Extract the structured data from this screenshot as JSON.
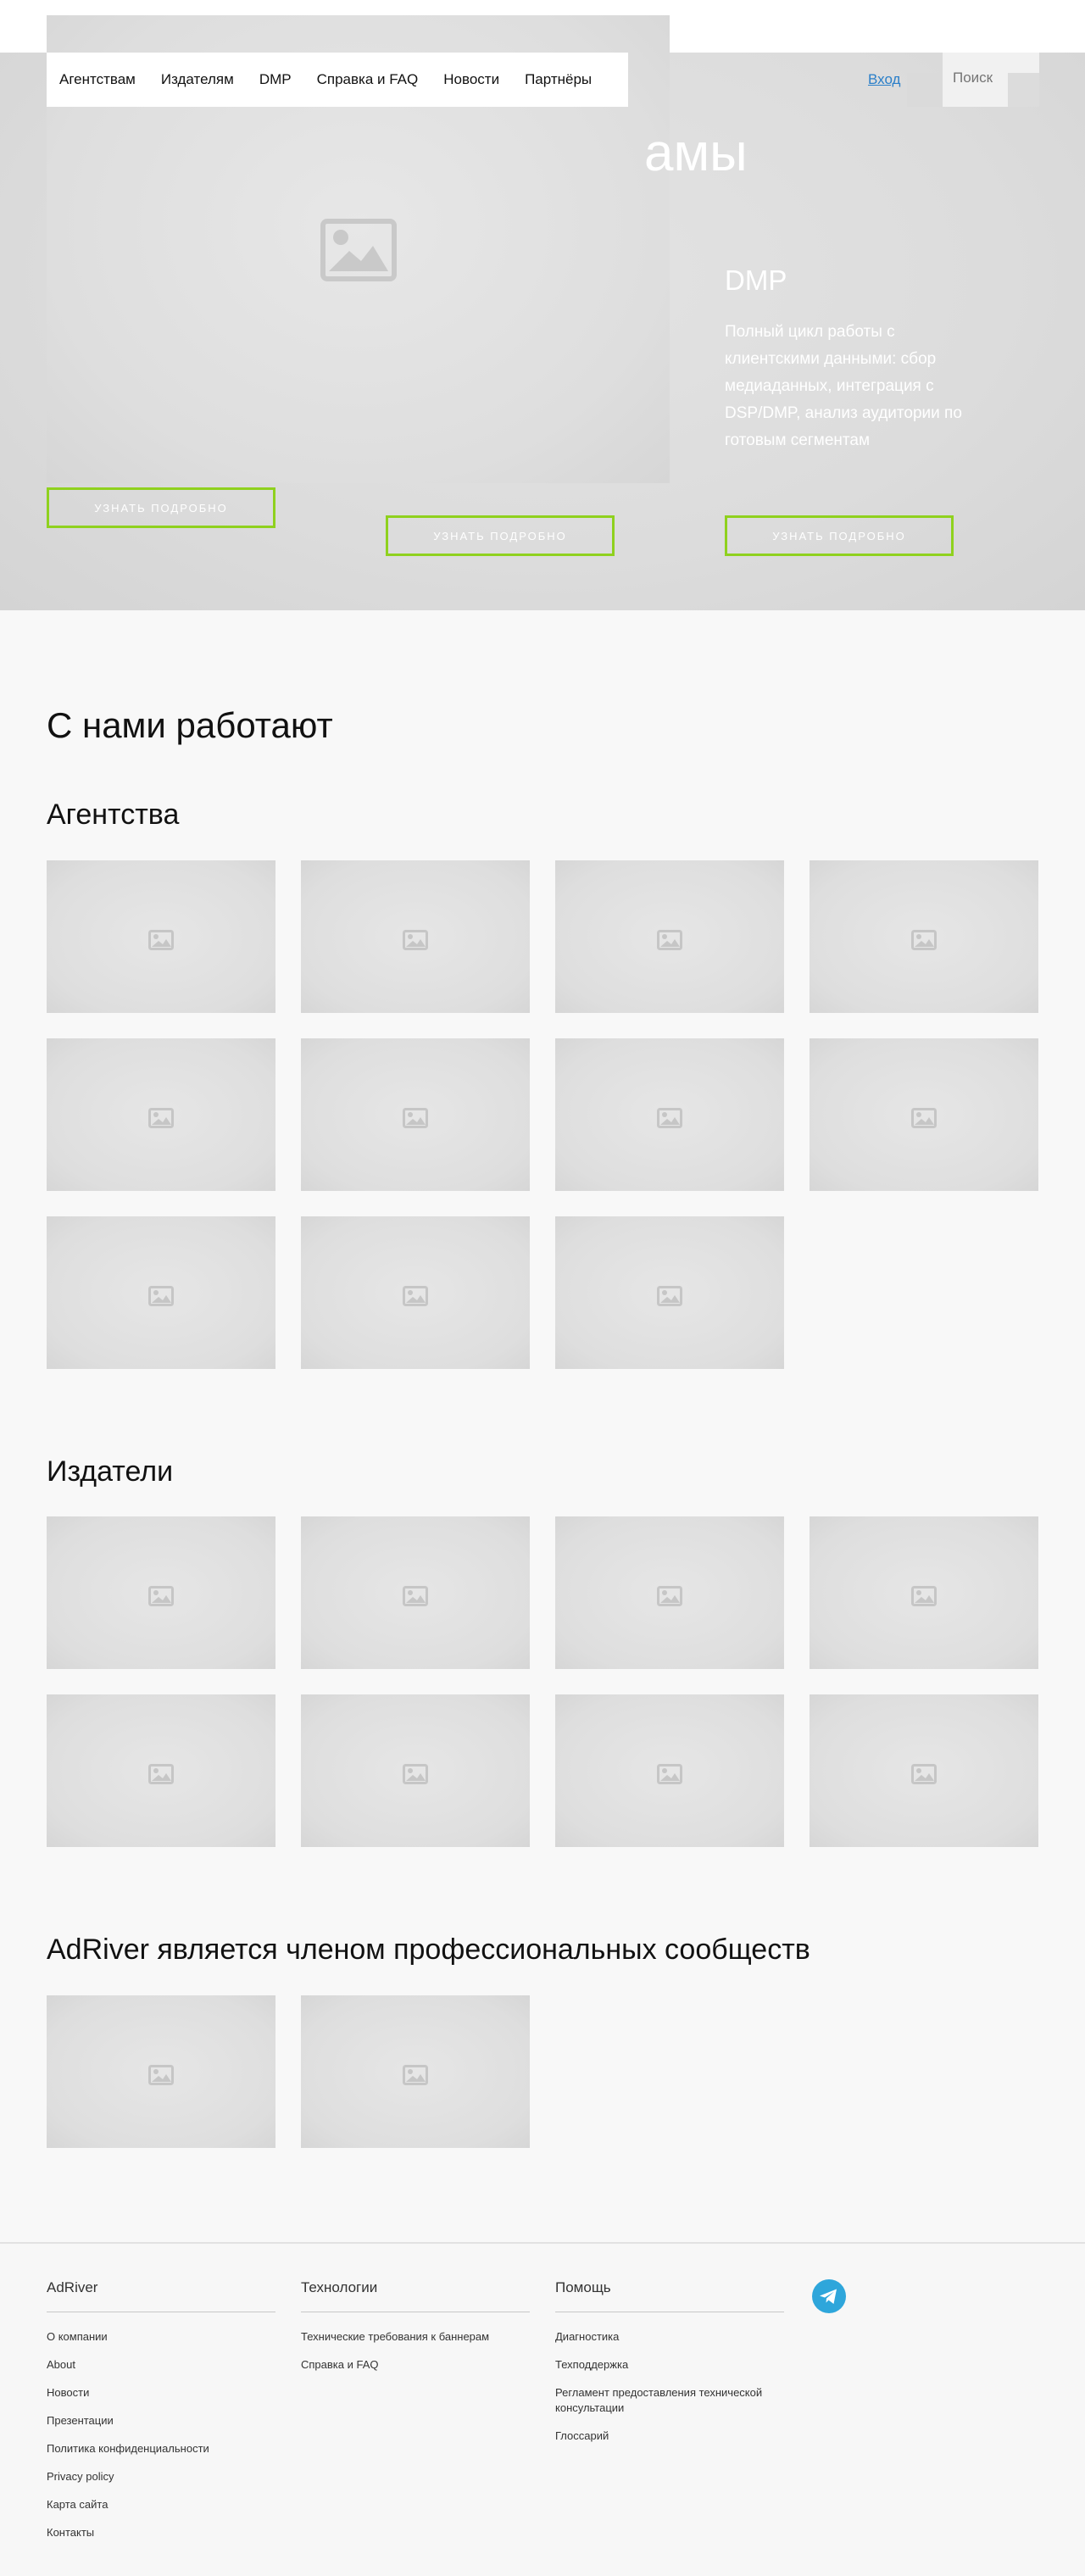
{
  "nav": {
    "items": [
      "Агентствам",
      "Издателям",
      "DMP",
      "Справка и FAQ",
      "Новости",
      "Партнёры"
    ],
    "login": "Вход",
    "search_placeholder": "Поиск"
  },
  "hero": {
    "title_fragment": "амы",
    "dmp_title": "DMP",
    "dmp_text": "Полный цикл работы с клиентскими данными: сбор медиаданных, интеграция с DSP/DMP, анализ аудитории по готовым сегментам",
    "button_label": "Узнать подробно"
  },
  "partners": {
    "title": "С нами работают",
    "agencies_title": "Агентства",
    "agencies_count": 11,
    "publishers_title": "Издатели",
    "publishers_count": 8,
    "communities_title": "AdRiver является членом профессиональных сообществ",
    "communities_count": 2
  },
  "footer": {
    "col1": {
      "title": "AdRiver",
      "links": [
        "О компании",
        "About",
        "Новости",
        "Презентации",
        "Политика конфиденциальности",
        "Privacy policy",
        "Карта сайта",
        "Контакты"
      ]
    },
    "col2": {
      "title": "Технологии",
      "links": [
        "Технические требования к баннерам",
        "Справка и FAQ"
      ]
    },
    "col3": {
      "title": "Помощь",
      "links": [
        "Диагностика",
        "Техподдержка",
        "Регламент предоставления технической консультации",
        "Глоссарий"
      ]
    },
    "social_icon": "telegram-icon"
  },
  "colors": {
    "accent_green": "#8fd11e",
    "link_blue": "#2a7fc9",
    "telegram_blue": "#2ea6db"
  }
}
